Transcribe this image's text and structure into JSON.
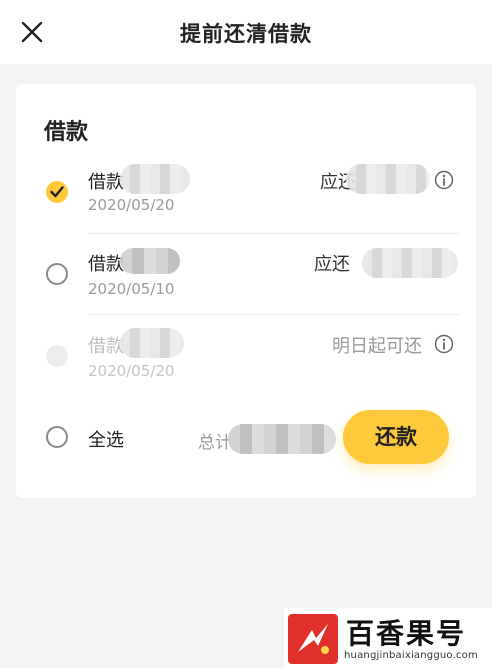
{
  "header": {
    "title": "提前还清借款",
    "close_icon": "close-icon"
  },
  "card": {
    "section_title": "借款",
    "loans": [
      {
        "label": "借款",
        "date": "2020/05/20",
        "right_label": "应还",
        "checked": true,
        "disabled": false,
        "show_info": true
      },
      {
        "label": "借款",
        "date": "2020/05/10",
        "right_label": "应还",
        "checked": false,
        "disabled": false,
        "show_info": false
      },
      {
        "label": "借款",
        "date": "2020/05/20",
        "right_label": "明日起可还",
        "checked": false,
        "disabled": true,
        "show_info": true
      }
    ],
    "footer": {
      "select_all_label": "全选",
      "total_label": "总计",
      "repay_button": "还款"
    }
  },
  "watermark": {
    "text": "百香果号",
    "url": "huangjinbaixiangguo.com"
  },
  "colors": {
    "accent": "#ffc93c",
    "brand_red": "#e0312b"
  }
}
